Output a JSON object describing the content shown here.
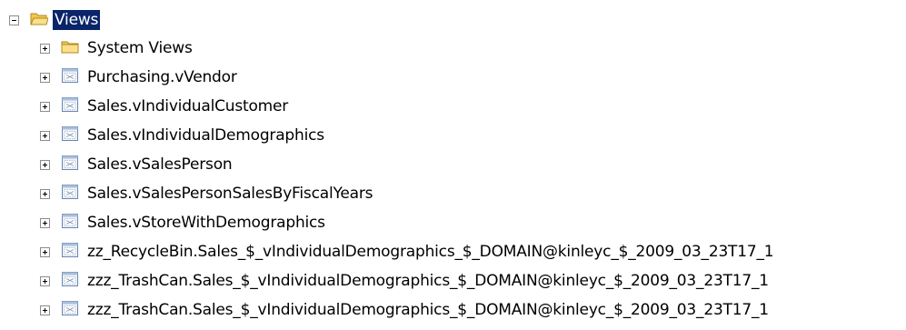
{
  "tree": {
    "root": {
      "label": "Views",
      "icon": "folder-open-icon",
      "expanded": true,
      "selected": true
    },
    "items": [
      {
        "label": "System Views",
        "icon": "folder-icon"
      },
      {
        "label": "Purchasing.vVendor",
        "icon": "view-icon"
      },
      {
        "label": "Sales.vIndividualCustomer",
        "icon": "view-icon"
      },
      {
        "label": "Sales.vIndividualDemographics",
        "icon": "view-icon"
      },
      {
        "label": "Sales.vSalesPerson",
        "icon": "view-icon"
      },
      {
        "label": "Sales.vSalesPersonSalesByFiscalYears",
        "icon": "view-icon"
      },
      {
        "label": "Sales.vStoreWithDemographics",
        "icon": "view-icon"
      },
      {
        "label": "zz_RecycleBin.Sales_$_vIndividualDemographics_$_DOMAIN@kinleyc_$_2009_03_23T17_1",
        "icon": "view-icon"
      },
      {
        "label": "zzz_TrashCan.Sales_$_vIndividualDemographics_$_DOMAIN@kinleyc_$_2009_03_23T17_1",
        "icon": "view-icon"
      },
      {
        "label": "zzz_TrashCan.Sales_$_vIndividualDemographics_$_DOMAIN@kinleyc_$_2009_03_23T17_1",
        "icon": "view-icon"
      }
    ]
  },
  "colors": {
    "selection_background": "#0a246a",
    "selection_text": "#ffffff",
    "folder": "#f5c64e"
  }
}
